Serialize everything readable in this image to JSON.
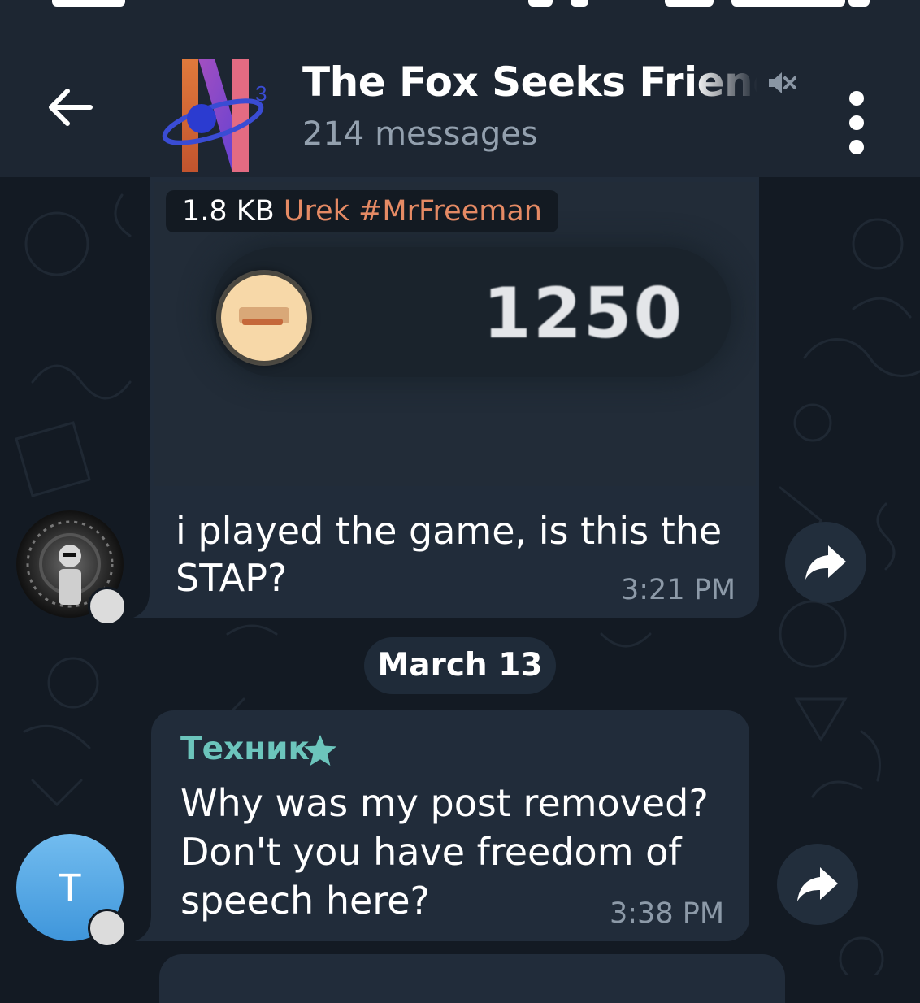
{
  "header": {
    "title": "The Fox Seeks Friends",
    "subtitle": "214 messages",
    "icons": {
      "back": "back-arrow-icon",
      "mute": "muted-speaker-icon",
      "menu": "more-vertical-icon"
    }
  },
  "messages": [
    {
      "attachment": {
        "size": "1.8 KB",
        "caption": "Urek #MrFreeman",
        "score": "1250"
      },
      "text": "i played the game, is this the STAP?",
      "time": "3:21 PM"
    },
    {
      "sender": "Техник",
      "text": "Why was my post removed? Don't you have freedom of speech here?",
      "time": "3:38 PM",
      "avatar_letter": "T"
    }
  ],
  "date_separator": "March 13",
  "colors": {
    "background": "#131a23",
    "header": "#1d2632",
    "bubble": "#212c3a",
    "sender_name": "#6cc5bc",
    "caption_accent": "#e58a64",
    "timestamp": "#8d9aa8"
  }
}
